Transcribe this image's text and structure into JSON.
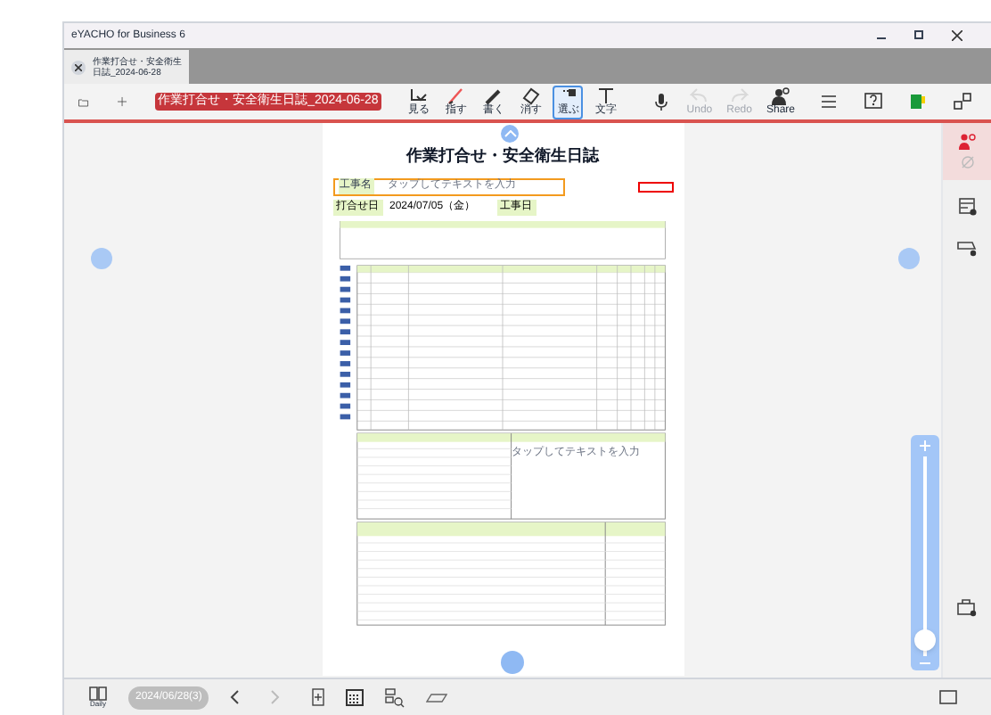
{
  "window": {
    "title": "eYACHO for Business 6"
  },
  "tab": {
    "label": "作業打合せ・安全衛生日誌_2024-06-28"
  },
  "toolbar": {
    "document_title": "作業打合せ・安全衛生日誌_2024-06-28",
    "tools": [
      {
        "kind": "view",
        "label": "見る",
        "selected": false,
        "disabled": false
      },
      {
        "kind": "point",
        "label": "指す",
        "selected": false,
        "disabled": false
      },
      {
        "kind": "pen",
        "label": "書く",
        "selected": false,
        "disabled": false
      },
      {
        "kind": "eraser",
        "label": "消す",
        "selected": false,
        "disabled": false
      },
      {
        "kind": "select",
        "label": "選ぶ",
        "selected": true,
        "disabled": false
      },
      {
        "kind": "text",
        "label": "文字",
        "selected": false,
        "disabled": false
      },
      {
        "kind": "mic",
        "selected": false,
        "disabled": false
      },
      {
        "kind": "undo",
        "label": "Undo",
        "selected": false,
        "disabled": true
      },
      {
        "kind": "redo",
        "label": "Redo",
        "selected": false,
        "disabled": true
      },
      {
        "kind": "share",
        "label": "Share",
        "selected": false,
        "disabled": false
      },
      {
        "kind": "menu",
        "selected": false,
        "disabled": false
      },
      {
        "kind": "help",
        "selected": false,
        "disabled": false
      },
      {
        "kind": "color",
        "selected": false,
        "disabled": false
      },
      {
        "kind": "expand",
        "selected": false,
        "disabled": false
      }
    ]
  },
  "document": {
    "title": "作業打合せ・安全衛生日誌",
    "project_label": "工事名",
    "project_placeholder": "タップしてテキストを入力",
    "meeting_date_label": "打合せ日",
    "meeting_date": "2024/07/05（金）",
    "work_date_label": "工事日",
    "notes_placeholder": "タップしてテキストを入力"
  },
  "zoom": {
    "level": 0.08
  },
  "bottom_bar": {
    "calendar_label": "Daily",
    "date": "2024/06/28(3)"
  }
}
